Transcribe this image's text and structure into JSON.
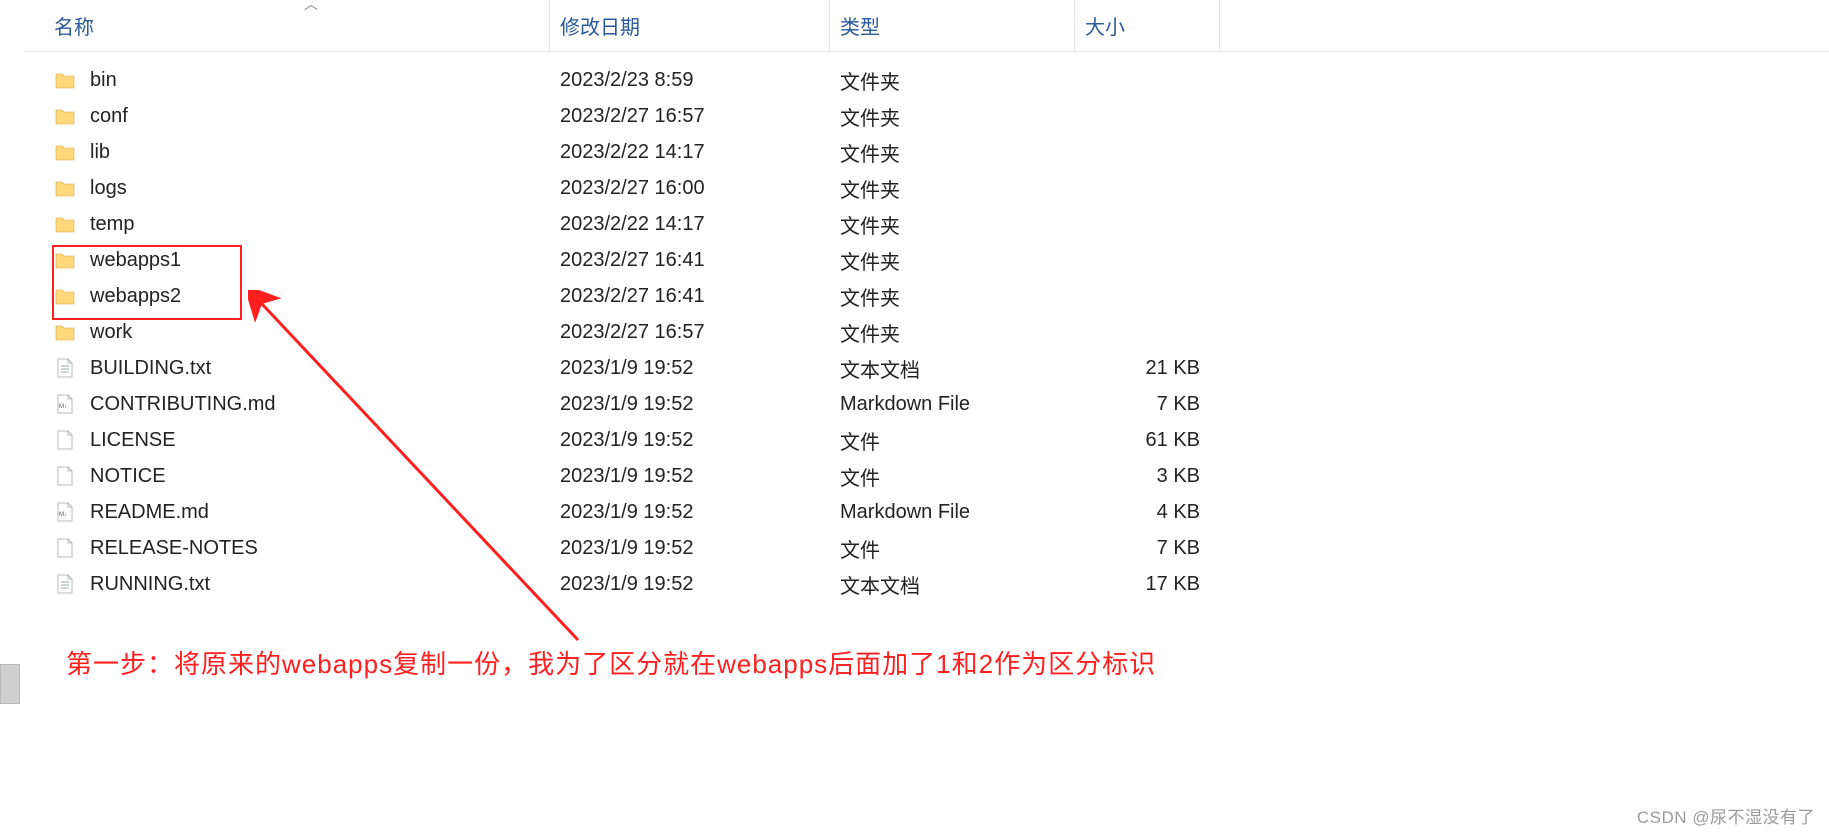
{
  "columns": {
    "name": "名称",
    "date": "修改日期",
    "type": "类型",
    "size": "大小"
  },
  "rows": [
    {
      "icon": "folder",
      "name": "bin",
      "date": "2023/2/23 8:59",
      "type": "文件夹",
      "size": ""
    },
    {
      "icon": "folder",
      "name": "conf",
      "date": "2023/2/27 16:57",
      "type": "文件夹",
      "size": ""
    },
    {
      "icon": "folder",
      "name": "lib",
      "date": "2023/2/22 14:17",
      "type": "文件夹",
      "size": ""
    },
    {
      "icon": "folder",
      "name": "logs",
      "date": "2023/2/27 16:00",
      "type": "文件夹",
      "size": ""
    },
    {
      "icon": "folder",
      "name": "temp",
      "date": "2023/2/22 14:17",
      "type": "文件夹",
      "size": ""
    },
    {
      "icon": "folder",
      "name": "webapps1",
      "date": "2023/2/27 16:41",
      "type": "文件夹",
      "size": ""
    },
    {
      "icon": "folder",
      "name": "webapps2",
      "date": "2023/2/27 16:41",
      "type": "文件夹",
      "size": ""
    },
    {
      "icon": "folder",
      "name": "work",
      "date": "2023/2/27 16:57",
      "type": "文件夹",
      "size": ""
    },
    {
      "icon": "text",
      "name": "BUILDING.txt",
      "date": "2023/1/9 19:52",
      "type": "文本文档",
      "size": "21 KB"
    },
    {
      "icon": "md",
      "name": "CONTRIBUTING.md",
      "date": "2023/1/9 19:52",
      "type": "Markdown File",
      "size": "7 KB"
    },
    {
      "icon": "blank",
      "name": "LICENSE",
      "date": "2023/1/9 19:52",
      "type": "文件",
      "size": "61 KB"
    },
    {
      "icon": "blank",
      "name": "NOTICE",
      "date": "2023/1/9 19:52",
      "type": "文件",
      "size": "3 KB"
    },
    {
      "icon": "md",
      "name": "README.md",
      "date": "2023/1/9 19:52",
      "type": "Markdown File",
      "size": "4 KB"
    },
    {
      "icon": "blank",
      "name": "RELEASE-NOTES",
      "date": "2023/1/9 19:52",
      "type": "文件",
      "size": "7 KB"
    },
    {
      "icon": "text",
      "name": "RUNNING.txt",
      "date": "2023/1/9 19:52",
      "type": "文本文档",
      "size": "17 KB"
    }
  ],
  "annotation": "第一步：将原来的webapps复制一份，我为了区分就在webapps后面加了1和2作为区分标识",
  "watermark": "CSDN @尿不湿没有了"
}
